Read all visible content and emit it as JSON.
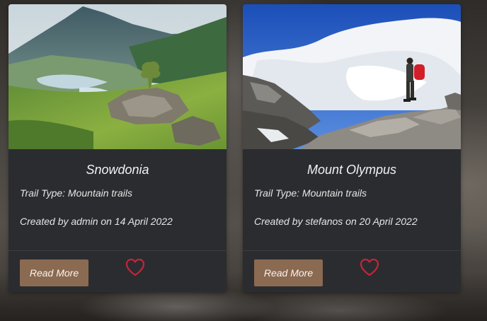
{
  "colors": {
    "card_bg": "#2b2c30",
    "button_bg": "#8b6a52",
    "heart": "#c3263b"
  },
  "cards": [
    {
      "title": "Snowdonia",
      "trail_type": "Trail Type: Mountain trails",
      "created": "Created by admin on 14 April 2022",
      "button_label": "Read More",
      "icon": "heart-outline-icon"
    },
    {
      "title": "Mount Olympus",
      "trail_type": "Trail Type: Mountain trails",
      "created": "Created by stefanos on 20 April 2022",
      "button_label": "Read More",
      "icon": "heart-outline-icon"
    }
  ]
}
